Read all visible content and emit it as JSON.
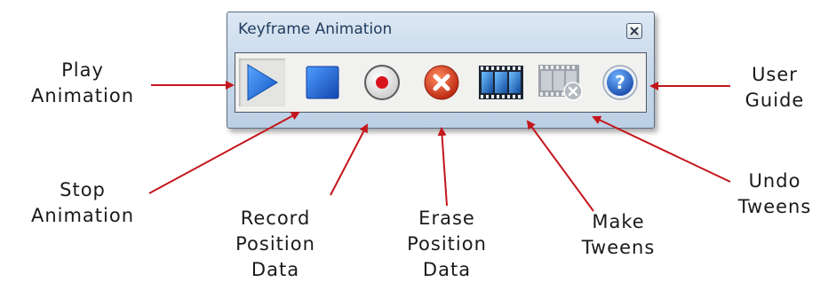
{
  "window": {
    "title": "Keyframe Animation",
    "close_icon": "close-icon"
  },
  "toolbar": [
    {
      "id": "play",
      "icon": "play-icon"
    },
    {
      "id": "stop",
      "icon": "stop-icon"
    },
    {
      "id": "record",
      "icon": "record-icon"
    },
    {
      "id": "erase",
      "icon": "erase-icon"
    },
    {
      "id": "make-tweens",
      "icon": "film-strip-icon"
    },
    {
      "id": "undo-tweens",
      "icon": "film-strip-undo-icon"
    },
    {
      "id": "user-guide",
      "icon": "help-icon"
    }
  ],
  "annotations": {
    "play": [
      "Play",
      "Animation"
    ],
    "stop": [
      "Stop",
      "Animation"
    ],
    "record": [
      "Record",
      "Position",
      "Data"
    ],
    "erase": [
      "Erase",
      "Position",
      "Data"
    ],
    "make_tweens": [
      "Make",
      "Tweens"
    ],
    "undo_tweens": [
      "Undo",
      "Tweens"
    ],
    "user_guide": [
      "User",
      "Guide"
    ]
  },
  "colors": {
    "arrow": "#c4161c",
    "play_blue": "#1f6fd6",
    "record_red": "#d9141c",
    "erase_red": "#d13a1f",
    "help_blue": "#1f5fbf"
  }
}
